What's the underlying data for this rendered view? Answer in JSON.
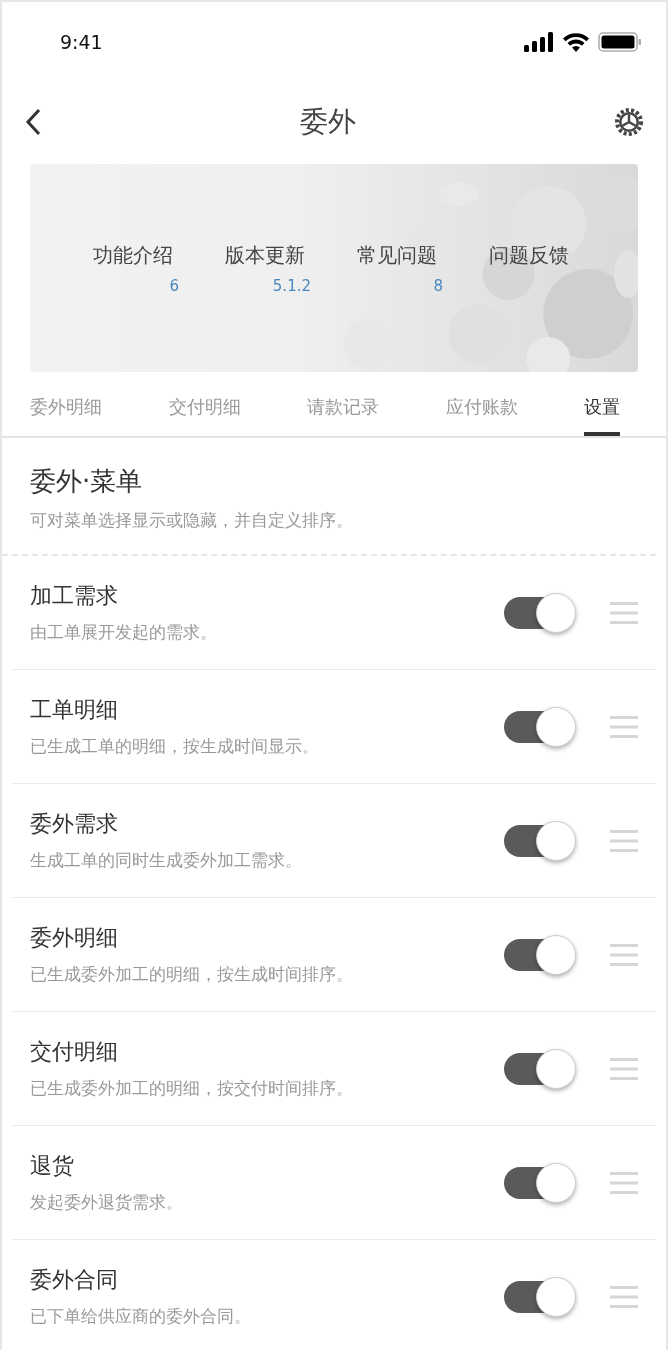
{
  "status_bar": {
    "time": "9:41"
  },
  "nav": {
    "title": "委外"
  },
  "banner": {
    "kind": "picture",
    "stats": [
      {
        "label": "功能介绍",
        "value": "6"
      },
      {
        "label": "版本更新",
        "value": "5.1.2"
      },
      {
        "label": "常见问题",
        "value": "8"
      },
      {
        "label": "问题反馈"
      }
    ]
  },
  "tabs": [
    {
      "label": "委外明细",
      "selected": false
    },
    {
      "label": "交付明细",
      "selected": false
    },
    {
      "label": "请款记录",
      "selected": false
    },
    {
      "label": "应付账款",
      "selected": false
    },
    {
      "label": "设置",
      "selected": true
    }
  ],
  "section": {
    "title": "委外·菜单",
    "description": "可对菜单选择显示或隐藏，并自定义排序。"
  },
  "menu_items": [
    {
      "title": "加工需求",
      "description": "由工单展开发起的需求。",
      "on": true
    },
    {
      "title": "工单明细",
      "description": "已生成工单的明细，按生成时间显示。",
      "on": true
    },
    {
      "title": "委外需求",
      "description": "生成工单的同时生成委外加工需求。",
      "on": true
    },
    {
      "title": "委外明细",
      "description": "已生成委外加工的明细，按生成时间排序。",
      "on": true
    },
    {
      "title": "交付明细",
      "description": "已生成委外加工的明细，按交付时间排序。",
      "on": true
    },
    {
      "title": "退货",
      "description": "发起委外退货需求。",
      "on": true
    },
    {
      "title": "委外合同",
      "description": "已下单给供应商的委外合同。",
      "on": true
    }
  ]
}
